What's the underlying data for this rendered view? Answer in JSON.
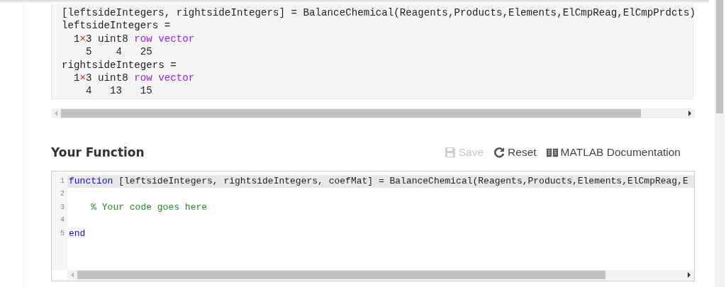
{
  "output": {
    "lines": [
      {
        "segments": [
          {
            "text": "[leftsideIntegers, rightsideIntegers] = BalanceChemical(Reagents,Products,Elements,ElCmpReag,ElCmpPrdcts)",
            "kind": "plain"
          }
        ]
      },
      {
        "segments": [
          {
            "text": "leftsideIntegers =",
            "kind": "plain"
          }
        ]
      },
      {
        "segments": [
          {
            "text": "  1",
            "kind": "plain"
          },
          {
            "text": "×",
            "kind": "times"
          },
          {
            "text": "3 uint8 ",
            "kind": "plain"
          },
          {
            "text": "row vector",
            "kind": "type"
          }
        ]
      },
      {
        "segments": [
          {
            "text": "    5    4   25",
            "kind": "plain"
          }
        ]
      },
      {
        "segments": [
          {
            "text": "rightsideIntegers =",
            "kind": "plain"
          }
        ]
      },
      {
        "segments": [
          {
            "text": "  1",
            "kind": "plain"
          },
          {
            "text": "×",
            "kind": "times"
          },
          {
            "text": "3 uint8 ",
            "kind": "plain"
          },
          {
            "text": "row vector",
            "kind": "type"
          }
        ]
      },
      {
        "segments": [
          {
            "text": "    4   13   15",
            "kind": "plain"
          }
        ]
      }
    ]
  },
  "section": {
    "title": "Your Function",
    "actions": [
      {
        "kind": "save",
        "label": "Save",
        "disabled": true
      },
      {
        "kind": "reset",
        "label": "Reset",
        "disabled": false
      },
      {
        "kind": "docs",
        "label": "MATLAB Documentation",
        "disabled": false
      }
    ]
  },
  "editor": {
    "lines": [
      {
        "number": "1",
        "current": true,
        "segments": [
          {
            "text": "function",
            "kind": "keyword"
          },
          {
            "text": " [leftsideIntegers, rightsideIntegers, coefMat] = BalanceChemical(Reagents,Products,Elements,ElCmpReag,E",
            "kind": "plain"
          }
        ]
      },
      {
        "number": "2",
        "current": false
      },
      {
        "number": "3",
        "current": false,
        "segments": [
          {
            "text": "    % Your code goes here",
            "kind": "comment"
          }
        ]
      },
      {
        "number": "4",
        "current": false
      },
      {
        "number": "5",
        "current": false,
        "segments": [
          {
            "text": "end",
            "kind": "keyword"
          }
        ]
      }
    ]
  }
}
